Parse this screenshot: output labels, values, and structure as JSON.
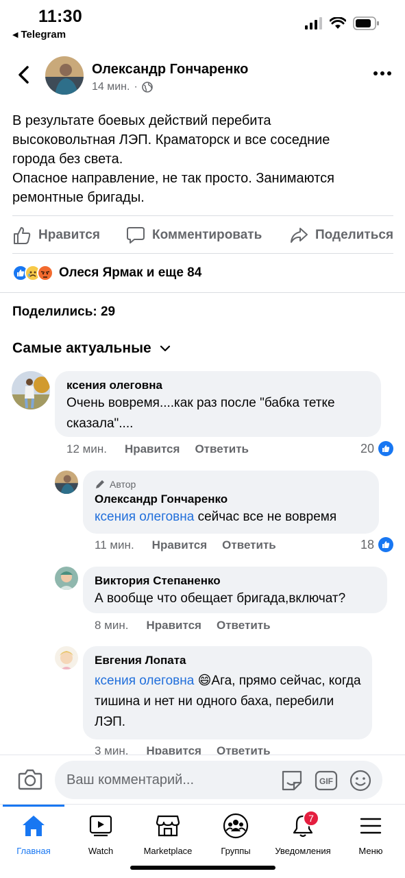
{
  "status_bar": {
    "time": "11:30",
    "back_app": "Telegram"
  },
  "post": {
    "author": "Олександр Гончаренко",
    "time": "14 мин.",
    "separator": "·",
    "lines": [
      "В результате боевых действий перебита",
      "высоковольтная ЛЭП. Краматорск и все соседние",
      "города без света.",
      "Опасное направление, не так просто. Занимаются",
      "ремонтные бригады."
    ]
  },
  "actions": {
    "like": "Нравится",
    "comment": "Комментировать",
    "share": "Поделиться"
  },
  "reactions": {
    "summary": "Олеся Ярмак и еще 84",
    "icons": [
      "like-icon",
      "sad-icon",
      "angry-icon"
    ]
  },
  "shares": "Поделились: 29",
  "sort": {
    "label": "Самые актуальные"
  },
  "comments": [
    {
      "name": "ксения олеговна",
      "text": "Очень вовремя....как раз после \"бабка тетке сказала\"....",
      "time": "12 мин.",
      "like": "Нравится",
      "reply": "Ответить",
      "likes": "20"
    },
    {
      "badge": "Автор",
      "name": "Олександр Гончаренко",
      "mention": "ксения олеговна",
      "text": " сейчас все не вовремя",
      "time": "11 мин.",
      "like": "Нравится",
      "reply": "Ответить",
      "likes": "18"
    },
    {
      "name": "Виктория Степаненко",
      "text": "А вообще что обещает бригада,включат?",
      "time": "8 мин.",
      "like": "Нравится",
      "reply": "Ответить"
    },
    {
      "name": "Евгения Лопата",
      "mention": "ксения олеговна",
      "emoji": "😄",
      "text": "Ага, прямо сейчас, когда тишина и нет ни одного баха, перебили ЛЭП.",
      "time": "3 мин.",
      "like": "Нравится",
      "reply": "Ответить"
    }
  ],
  "composer": {
    "placeholder": "Ваш комментарий..."
  },
  "tabs": [
    {
      "label": "Главная",
      "icon": "home-icon",
      "active": true
    },
    {
      "label": "Watch",
      "icon": "watch-icon"
    },
    {
      "label": "Marketplace",
      "icon": "marketplace-icon"
    },
    {
      "label": "Группы",
      "icon": "groups-icon"
    },
    {
      "label": "Уведомления",
      "icon": "bell-icon",
      "badge": "7"
    },
    {
      "label": "Меню",
      "icon": "menu-icon"
    }
  ],
  "colors": {
    "accent": "#1877f2",
    "mention": "#216fdb",
    "badge": "#e41e3f",
    "bubble": "#f0f2f5",
    "secondary_text": "#65676b"
  }
}
